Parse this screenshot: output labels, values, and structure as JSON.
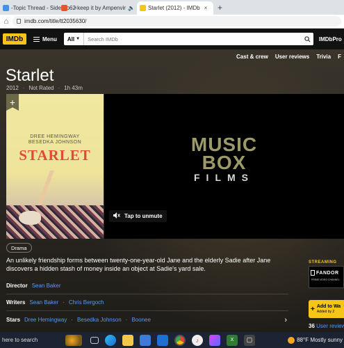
{
  "browser": {
    "tabs": [
      {
        "title": "-Topic Thread - Side Ro",
        "close": "×",
        "color": "#4a90e2"
      },
      {
        "title": "62 keep it by Ampenvir",
        "close": "×",
        "color": "#e8542c",
        "speaker": "🔈"
      },
      {
        "title": "Starlet (2012) - IMDb",
        "close": "×",
        "color": "#f5c518",
        "active": true
      }
    ],
    "new_tab": "+",
    "url": "imdb.com/title/tt2035630/"
  },
  "imdb_nav": {
    "logo": "IMDb",
    "menu_label": "Menu",
    "search_scope": "All",
    "search_placeholder": "Search IMDb",
    "pro": "IMDbPro"
  },
  "subnav": [
    "Cast & crew",
    "User reviews",
    "Trivia",
    "F"
  ],
  "movie": {
    "title": "Starlet",
    "year": "2012",
    "rating": "Not Rated",
    "runtime": "1h 43m",
    "genre": "Drama",
    "plot": "An unlikely friendship forms between twenty-one-year-old Jane and the elderly Sadie after Jane discovers a hidden stash of money inside an object at Sadie's yard sale."
  },
  "poster": {
    "cast_line1": "DREE HEMINGWAY",
    "cast_line2": "BESEDKA JOHNSON",
    "title": "STARLET",
    "add_icon": "+"
  },
  "video": {
    "logo_line1": "MUSIC",
    "logo_line2": "BOX",
    "logo_line3": "FILMS",
    "unmute_label": "Tap to unmute"
  },
  "credits": {
    "director_label": "Director",
    "directors": [
      "Sean Baker"
    ],
    "writers_label": "Writers",
    "writers": [
      "Sean Baker",
      "Chris Bergoch"
    ],
    "stars_label": "Stars",
    "stars": [
      "Dree Hemingway",
      "Besedka Johnson",
      "Boonee"
    ],
    "separator": "·",
    "chevron": "›"
  },
  "sidebar": {
    "streaming_label": "STREAMING",
    "provider": "FANDOR",
    "provider_sub": "PRIME VIDEO CHANNEL",
    "watchlist_label": "Add to Wa",
    "watchlist_sub": "Added by 2",
    "reviews_count": "36",
    "reviews_label": "User reviews"
  },
  "taskbar": {
    "search_text": "here to search",
    "weather": "88°F  Mostly sunny"
  },
  "colors": {
    "imdb_yellow": "#f5c518",
    "link_blue": "#5799ef",
    "nav_black": "#121212"
  }
}
